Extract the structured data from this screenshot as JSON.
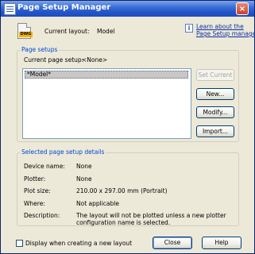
{
  "window": {
    "title": "Page Setup Manager",
    "close_glyph": "×"
  },
  "header": {
    "current_layout_label": "Current layout:",
    "current_layout_value": "Model",
    "help_link_line1": "Learn about the",
    "help_link_line2": "Page Setup manager"
  },
  "page_setups": {
    "title": "Page setups",
    "current_label": "Current page setup:",
    "current_value": "<None>",
    "items": [
      "*Model*"
    ],
    "buttons": {
      "set_current": "Set Current",
      "new": "New...",
      "modify": "Modify...",
      "import": "Import..."
    }
  },
  "details": {
    "title": "Selected page setup details",
    "rows": [
      {
        "label": "Device name:",
        "value": "None"
      },
      {
        "label": "Plotter:",
        "value": "None"
      },
      {
        "label": "Plot size:",
        "value": "210.00 x 297.00 mm (Portrait)"
      },
      {
        "label": "Where:",
        "value": "Not applicable"
      },
      {
        "label": "Description:",
        "value_line1": "The layout will not be plotted unless a new plotter",
        "value_line2": "configuration name is selected."
      }
    ]
  },
  "footer": {
    "checkbox_label": "Display when creating a new layout",
    "checkbox_checked": false,
    "close": "Close",
    "help": "Help"
  },
  "icons": {
    "layout_icon_tag": "DWG"
  }
}
